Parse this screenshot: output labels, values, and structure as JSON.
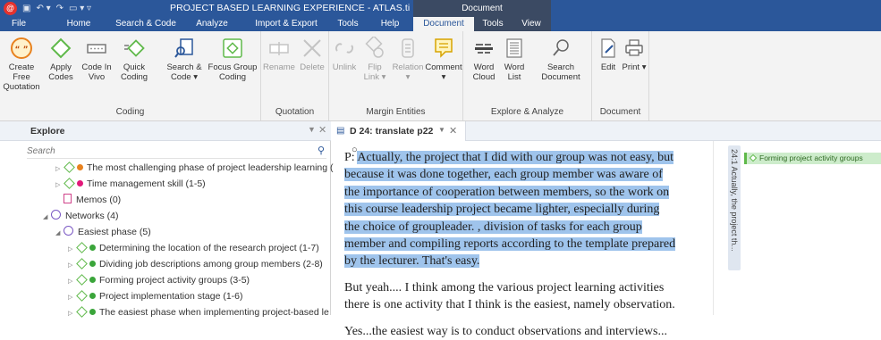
{
  "titlebar": {
    "logo": "@",
    "title": "PROJECT BASED LEARNING EXPERIENCE - ATLAS.ti",
    "context_group": "Document",
    "quick_access": [
      "save-icon",
      "undo-icon",
      "redo-icon",
      "customize-icon"
    ]
  },
  "tabs": [
    {
      "label": "File"
    },
    {
      "label": "Home"
    },
    {
      "label": "Search & Code"
    },
    {
      "label": "Analyze"
    },
    {
      "label": "Import & Export"
    },
    {
      "label": "Tools"
    },
    {
      "label": "Help"
    },
    {
      "label": "Document",
      "active": true
    },
    {
      "label": "Tools",
      "context": true
    },
    {
      "label": "View",
      "context": true
    }
  ],
  "ribbon": {
    "groups": [
      {
        "label": "Coding",
        "buttons": [
          {
            "label": "Create Free Quotation",
            "icon": "quotation-icon"
          },
          {
            "label": "Apply Codes",
            "icon": "apply-codes-icon"
          },
          {
            "label": "Code In Vivo",
            "icon": "code-in-vivo-icon"
          },
          {
            "label": "Quick Coding",
            "icon": "quick-coding-icon"
          },
          {
            "label": "Search & Code ▾",
            "icon": "search-code-icon"
          },
          {
            "label": "Focus Group Coding",
            "icon": "focus-group-icon"
          }
        ]
      },
      {
        "label": "Quotation",
        "buttons": [
          {
            "label": "Rename",
            "icon": "rename-icon",
            "disabled": true
          },
          {
            "label": "Delete",
            "icon": "delete-icon",
            "disabled": true
          }
        ]
      },
      {
        "label": "Margin Entities",
        "buttons": [
          {
            "label": "Unlink",
            "icon": "unlink-icon",
            "disabled": true
          },
          {
            "label": "Flip Link ▾",
            "icon": "flip-link-icon",
            "disabled": true
          },
          {
            "label": "Relation ▾",
            "icon": "relation-icon",
            "disabled": true
          },
          {
            "label": "Comment ▾",
            "icon": "comment-icon"
          }
        ]
      },
      {
        "label": "Explore & Analyze",
        "buttons": [
          {
            "label": "Word Cloud",
            "icon": "word-cloud-icon"
          },
          {
            "label": "Word List",
            "icon": "word-list-icon"
          },
          {
            "label": "Search Document",
            "icon": "search-document-icon"
          }
        ]
      },
      {
        "label": "Document",
        "buttons": [
          {
            "label": "Edit",
            "icon": "edit-icon"
          },
          {
            "label": "Print ▾",
            "icon": "print-icon"
          }
        ]
      }
    ]
  },
  "explore": {
    "title": "Explore",
    "search_placeholder": "Search",
    "tree": [
      {
        "label": "The most challenging phase of project leadership learning (",
        "kind": "code",
        "dot": "#e8821e",
        "level": 1,
        "arrow": "▷"
      },
      {
        "label": "Time management skill (1-5)",
        "kind": "code",
        "dot": "#e2197a",
        "level": 1,
        "arrow": "▷"
      },
      {
        "label": "Memos (0)",
        "kind": "memos",
        "level": 0,
        "arrow": ""
      },
      {
        "label": "Networks (4)",
        "kind": "networks",
        "level": 0,
        "arrow": "◢"
      },
      {
        "label": "Easiest phase (5)",
        "kind": "network",
        "level": 1,
        "arrow": "◢"
      },
      {
        "label": "Determining the location of the research project (1-7)",
        "kind": "code",
        "dot": "#3aa53a",
        "level": 2,
        "arrow": "▷"
      },
      {
        "label": "Dividing job descriptions among group members (2-8)",
        "kind": "code",
        "dot": "#3aa53a",
        "level": 2,
        "arrow": "▷"
      },
      {
        "label": "Forming project activity groups (3-5)",
        "kind": "code",
        "dot": "#3aa53a",
        "level": 2,
        "arrow": "▷"
      },
      {
        "label": "Project implementation stage (1-6)",
        "kind": "code",
        "dot": "#3aa53a",
        "level": 2,
        "arrow": "▷"
      },
      {
        "label": "The easiest phase when implementing project-based le",
        "kind": "code",
        "dot": "#3aa53a",
        "level": 2,
        "arrow": "▷"
      }
    ]
  },
  "document": {
    "tab_title": "D 24: translate p22",
    "para1_prefix": "P: ",
    "para1_highlight": "Actually, the project that I did with our group was not easy, but because it was done together, each group member was aware of the importance of cooperation between members, so the work on this course leadership project became lighter, especially during the choice of groupleader. , division of tasks for each group member and compiling reports according to the template prepared by the lecturer. That's easy.",
    "para2": "But yeah.... I think among the various project learning activities there is one activity that I think is the easiest, namely observation.",
    "para3": "Yes...the easiest way is to conduct observations and interviews..."
  },
  "margin": {
    "quotation_label": "24:1 Actually, the project th...",
    "code_label": "Forming project activity groups"
  },
  "colors": {
    "accent": "#2b579a",
    "highlight": "#9fc4ec",
    "code_green": "#5fb94a"
  }
}
